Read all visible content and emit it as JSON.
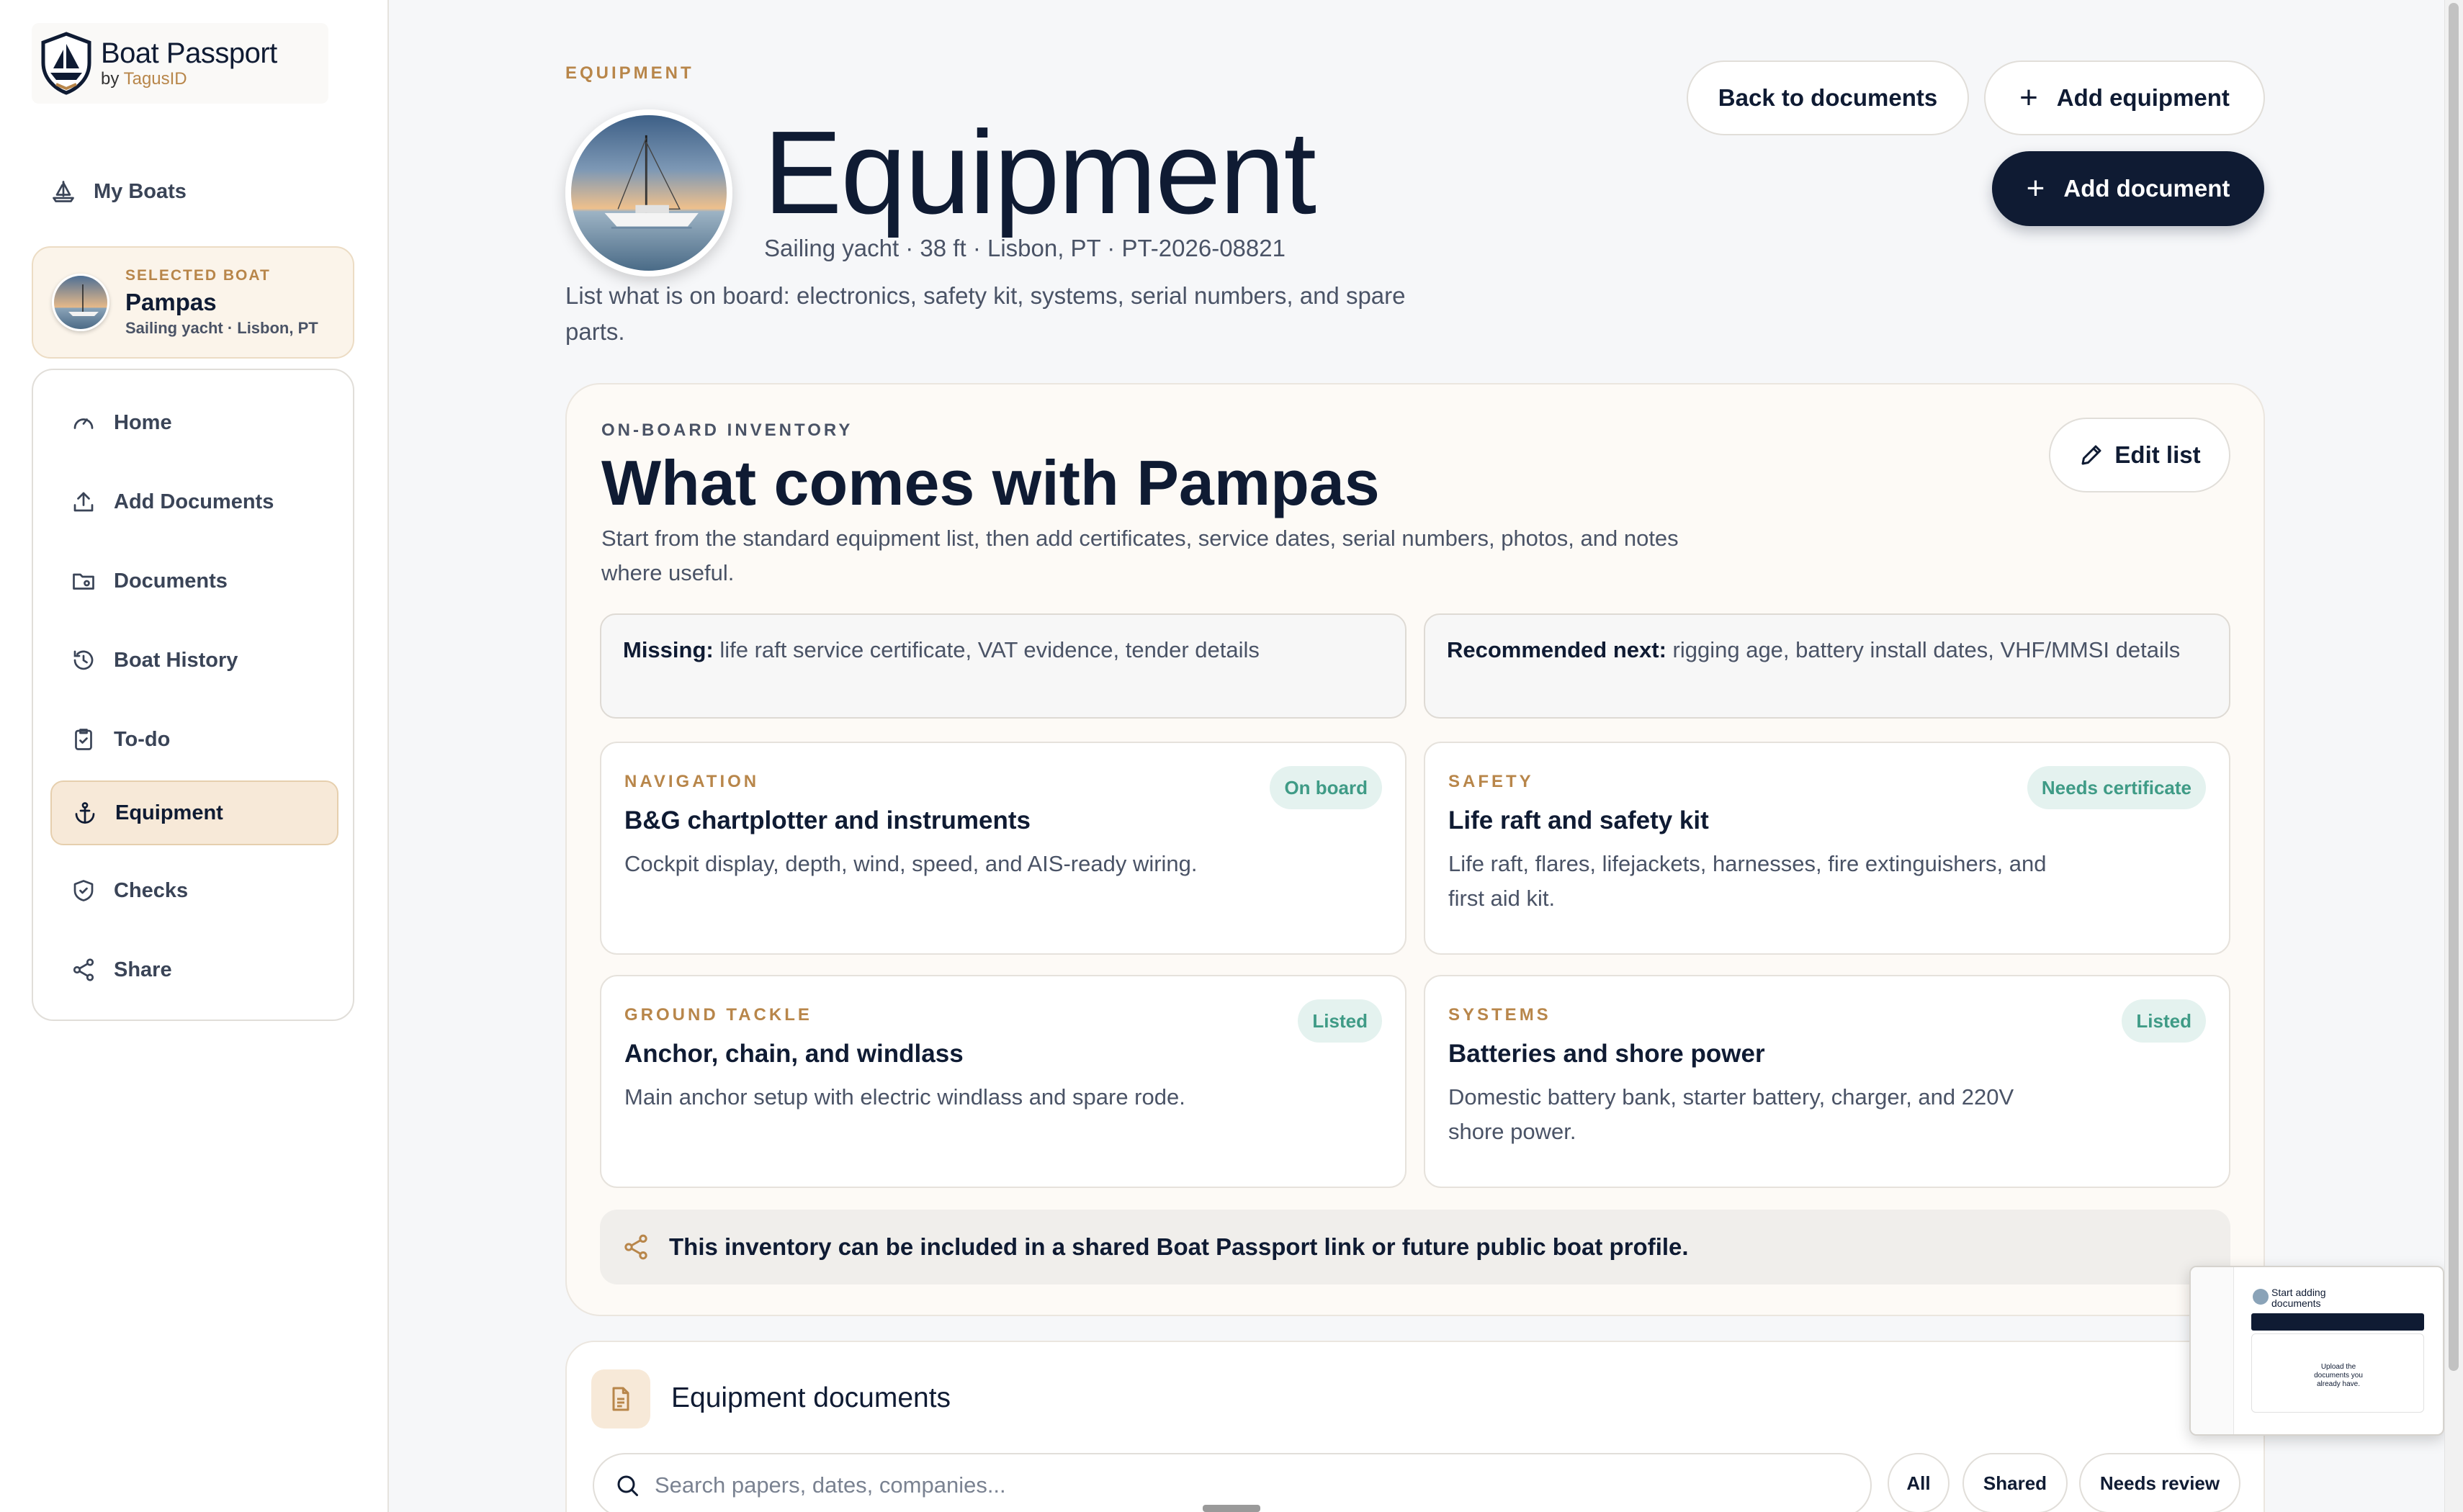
{
  "brand": {
    "title": "Boat Passport",
    "by": "by",
    "company": "TagusID"
  },
  "sidebar": {
    "my_boats": "My Boats",
    "selected_boat": {
      "kicker": "SELECTED BOAT",
      "name": "Pampas",
      "meta": "Sailing yacht · Lisbon, PT"
    },
    "items": [
      {
        "label": "Home",
        "icon": "gauge-icon"
      },
      {
        "label": "Add Documents",
        "icon": "upload-icon"
      },
      {
        "label": "Documents",
        "icon": "folder-icon"
      },
      {
        "label": "Boat History",
        "icon": "history-icon"
      },
      {
        "label": "To-do",
        "icon": "clipboard-check-icon"
      },
      {
        "label": "Equipment",
        "icon": "anchor-icon",
        "active": true
      },
      {
        "label": "Checks",
        "icon": "shield-check-icon"
      },
      {
        "label": "Share",
        "icon": "share-icon"
      }
    ]
  },
  "header": {
    "kicker": "EQUIPMENT",
    "title": "Equipment",
    "meta": "Sailing yacht · 38 ft · Lisbon, PT · PT-2026-08821",
    "intro": "List what is on board: electronics, safety kit, systems, serial numbers, and spare parts.",
    "back_label": "Back to documents",
    "add_equipment_label": "Add equipment",
    "add_document_label": "Add document",
    "plus": "+"
  },
  "inventory": {
    "kicker": "ON-BOARD INVENTORY",
    "title": "What comes with Pampas",
    "description": "Start from the standard equipment list, then add certificates, service dates, serial numbers, photos, and notes where useful.",
    "edit_label": "Edit list",
    "missing": {
      "label": "Missing:",
      "text": "life raft service certificate, VAT evidence, tender details"
    },
    "recommended": {
      "label": "Recommended next:",
      "text": "rigging age, battery install dates, VHF/MMSI details"
    },
    "items": [
      {
        "category": "NAVIGATION",
        "title": "B&G chartplotter and instruments",
        "description": "Cockpit display, depth, wind, speed, and AIS-ready wiring.",
        "status": "On board"
      },
      {
        "category": "SAFETY",
        "title": "Life raft and safety kit",
        "description": "Life raft, flares, lifejackets, harnesses, fire extinguishers, and first aid kit.",
        "status": "Needs certificate"
      },
      {
        "category": "GROUND TACKLE",
        "title": "Anchor, chain, and windlass",
        "description": "Main anchor setup with electric windlass and spare rode.",
        "status": "Listed"
      },
      {
        "category": "SYSTEMS",
        "title": "Batteries and shore power",
        "description": "Domestic battery bank, starter battery, charger, and 220V shore power.",
        "status": "Listed"
      }
    ],
    "share_note": "This inventory can be included in a shared Boat Passport link or future public boat profile."
  },
  "documents": {
    "title": "Equipment documents",
    "search_placeholder": "Search papers, dates, companies...",
    "filters": [
      "All",
      "Shared",
      "Needs review"
    ]
  },
  "preview": {
    "title": "Start adding documents",
    "body": "Upload the documents you already have."
  },
  "colors": {
    "navy": "#0f1b33",
    "accent": "#b8864a",
    "status_green": "#3f9b86",
    "active_bg": "#f7e9d8"
  }
}
